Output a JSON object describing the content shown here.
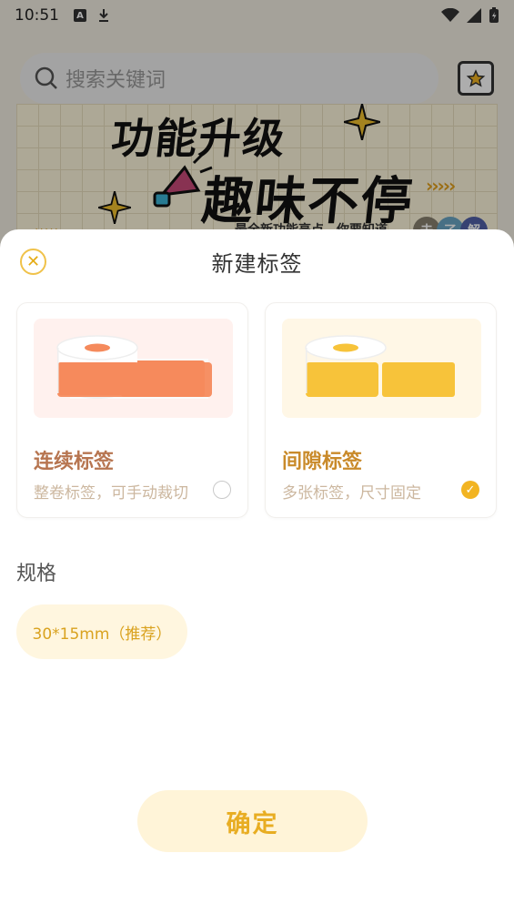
{
  "status_bar": {
    "time": "10:51"
  },
  "background": {
    "search_placeholder": "搜索关键词",
    "banner_line1": "功能升级",
    "banner_line2": "趣味不停",
    "banner_sub": "最全新功能亮点，你要知道",
    "badges": [
      "去",
      "了",
      "解"
    ]
  },
  "sheet": {
    "title": "新建标签",
    "close_icon": "close-icon",
    "options": [
      {
        "title": "连续标签",
        "desc": "整卷标签，可手动裁切",
        "selected": false,
        "color": "#f58a5c"
      },
      {
        "title": "间隙标签",
        "desc": "多张标签，尺寸固定",
        "selected": true,
        "color": "#f7c33a"
      }
    ],
    "spec_label": "规格",
    "spec_option": "30*15mm（推荐）",
    "confirm_label": "确定"
  },
  "colors": {
    "accent": "#f2b422",
    "accent_light": "#fff4d8"
  }
}
